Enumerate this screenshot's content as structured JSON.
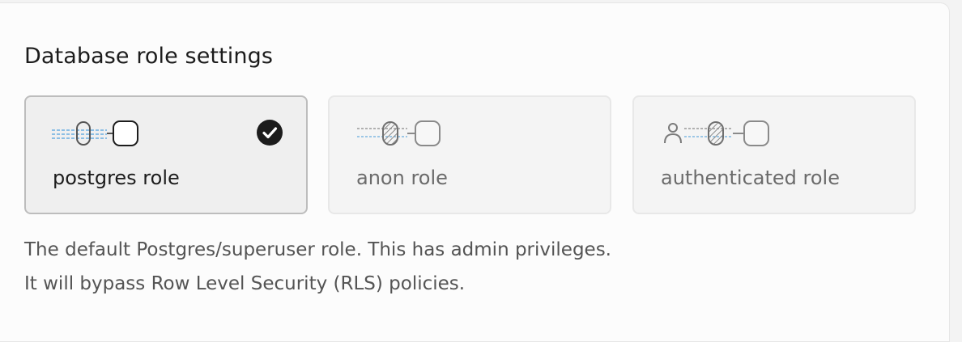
{
  "panel": {
    "title": "Database role settings"
  },
  "roles": [
    {
      "label": "postgres role",
      "selected": true,
      "icon": "postgres-role-icon"
    },
    {
      "label": "anon role",
      "selected": false,
      "icon": "anon-role-icon"
    },
    {
      "label": "authenticated role",
      "selected": false,
      "icon": "authenticated-role-icon"
    }
  ],
  "description": {
    "line1": "The default Postgres/superuser role. This has admin privileges.",
    "line2": "It will bypass Row Level Security (RLS) policies."
  },
  "colors": {
    "accent_dashed": "#6aaee0",
    "selected_border": "#bdbdbd",
    "check_fill": "#1c1c1c"
  }
}
